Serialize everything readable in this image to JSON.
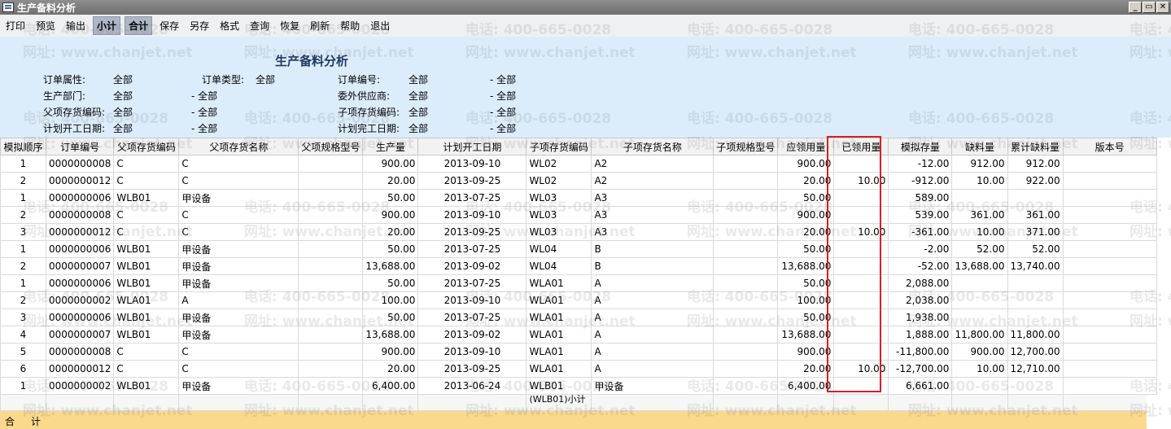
{
  "window": {
    "title": "生产备料分析",
    "buttons": [
      "_",
      "▭",
      "✕"
    ]
  },
  "toolbar": [
    {
      "label": "打印",
      "active": false
    },
    {
      "label": "预览",
      "active": false
    },
    {
      "label": "输出",
      "active": false
    },
    {
      "label": "小计",
      "active": true
    },
    {
      "label": "合计",
      "active": true
    },
    {
      "label": "保存",
      "active": false
    },
    {
      "label": "另存",
      "active": false
    },
    {
      "label": "格式",
      "active": false
    },
    {
      "label": "查询",
      "active": false
    },
    {
      "label": "恢复",
      "active": false
    },
    {
      "label": "刷新",
      "active": false
    },
    {
      "label": "帮助",
      "active": false
    },
    {
      "label": "退出",
      "active": false
    }
  ],
  "report": {
    "title": "生产备料分析"
  },
  "filters": {
    "order_attr_label": "订单属性:",
    "order_attr_value": "全部",
    "order_type_label": "订单类型:",
    "order_type_value": "全部",
    "order_no_label": "订单编号:",
    "order_no_from": "全部",
    "order_no_to": "- 全部",
    "dept_label": "生产部门:",
    "dept_from": "全部",
    "dept_to": "- 全部",
    "supplier_label": "委外供应商:",
    "supplier_from": "全部",
    "supplier_to": "- 全部",
    "parent_code_label": "父项存货编码:",
    "parent_code_from": "全部",
    "parent_code_to": "- 全部",
    "child_code_label": "子项存货编码:",
    "child_code_from": "全部",
    "child_code_to": "- 全部",
    "start_label": "计划开工日期:",
    "start_from": "全部",
    "start_to": "- 全部",
    "end_label": "计划完工日期:",
    "end_from": "全部",
    "end_to": "- 全部"
  },
  "watermark": {
    "phone": "电话: 400-665-0028",
    "site": "网址: www.chanjet.net"
  },
  "table": {
    "columns": [
      "模拟顺序",
      "订单编号",
      "父项存货编码",
      "父项存货名称",
      "父项规格型号",
      "生产量",
      "计划开工日期",
      "子项存货编码",
      "子项存货名称",
      "子项规格型号",
      "应领用量",
      "已领用量",
      "模拟存量",
      "缺料量",
      "累计缺料量",
      "版本号"
    ],
    "rows": [
      [
        "1",
        "0000000008",
        "C",
        "C",
        "",
        "900.00",
        "2013-09-10",
        "WL02",
        "A2",
        "",
        "900.00",
        "",
        "-12.00",
        "912.00",
        "912.00",
        ""
      ],
      [
        "2",
        "0000000012",
        "C",
        "C",
        "",
        "20.00",
        "2013-09-25",
        "WL02",
        "A2",
        "",
        "20.00",
        "10.00",
        "-912.00",
        "10.00",
        "922.00",
        ""
      ],
      [
        "1",
        "0000000006",
        "WLB01",
        "甲设备",
        "",
        "50.00",
        "2013-07-25",
        "WL03",
        "A3",
        "",
        "50.00",
        "",
        "589.00",
        "",
        "",
        ""
      ],
      [
        "2",
        "0000000008",
        "C",
        "C",
        "",
        "900.00",
        "2013-09-10",
        "WL03",
        "A3",
        "",
        "900.00",
        "",
        "539.00",
        "361.00",
        "361.00",
        ""
      ],
      [
        "3",
        "0000000012",
        "C",
        "C",
        "",
        "20.00",
        "2013-09-25",
        "WL03",
        "A3",
        "",
        "20.00",
        "10.00",
        "-361.00",
        "10.00",
        "371.00",
        ""
      ],
      [
        "1",
        "0000000006",
        "WLB01",
        "甲设备",
        "",
        "50.00",
        "2013-07-25",
        "WL04",
        "B",
        "",
        "50.00",
        "",
        "-2.00",
        "52.00",
        "52.00",
        ""
      ],
      [
        "2",
        "0000000007",
        "WLB01",
        "甲设备",
        "",
        "13,688.00",
        "2013-09-02",
        "WL04",
        "B",
        "",
        "13,688.00",
        "",
        "-52.00",
        "13,688.00",
        "13,740.00",
        ""
      ],
      [
        "1",
        "0000000006",
        "WLB01",
        "甲设备",
        "",
        "50.00",
        "2013-07-25",
        "WLA01",
        "A",
        "",
        "50.00",
        "",
        "2,088.00",
        "",
        "",
        ""
      ],
      [
        "2",
        "0000000002",
        "WLA01",
        "A",
        "",
        "100.00",
        "2013-09-10",
        "WLA01",
        "A",
        "",
        "100.00",
        "",
        "2,038.00",
        "",
        "",
        ""
      ],
      [
        "3",
        "0000000006",
        "WLB01",
        "甲设备",
        "",
        "50.00",
        "2013-07-25",
        "WLA01",
        "A",
        "",
        "50.00",
        "",
        "1,938.00",
        "",
        "",
        ""
      ],
      [
        "4",
        "0000000007",
        "WLB01",
        "甲设备",
        "",
        "13,688.00",
        "2013-09-02",
        "WLA01",
        "A",
        "",
        "13,688.00",
        "",
        "1,888.00",
        "11,800.00",
        "11,800.00",
        ""
      ],
      [
        "5",
        "0000000008",
        "C",
        "C",
        "",
        "900.00",
        "2013-09-10",
        "WLA01",
        "A",
        "",
        "900.00",
        "",
        "-11,800.00",
        "900.00",
        "12,700.00",
        ""
      ],
      [
        "6",
        "0000000012",
        "C",
        "C",
        "",
        "20.00",
        "2013-09-25",
        "WLA01",
        "A",
        "",
        "20.00",
        "10.00",
        "-12,700.00",
        "10.00",
        "12,710.00",
        ""
      ],
      [
        "1",
        "0000000002",
        "WLB01",
        "甲设备",
        "",
        "6,400.00",
        "2013-06-24",
        "WLB01",
        "甲设备",
        "",
        "6,400.00",
        "",
        "6,661.00",
        "",
        "",
        ""
      ]
    ],
    "subtotal_label": "(WLB01)小计"
  },
  "footer": {
    "he": "合",
    "ji": "计"
  }
}
